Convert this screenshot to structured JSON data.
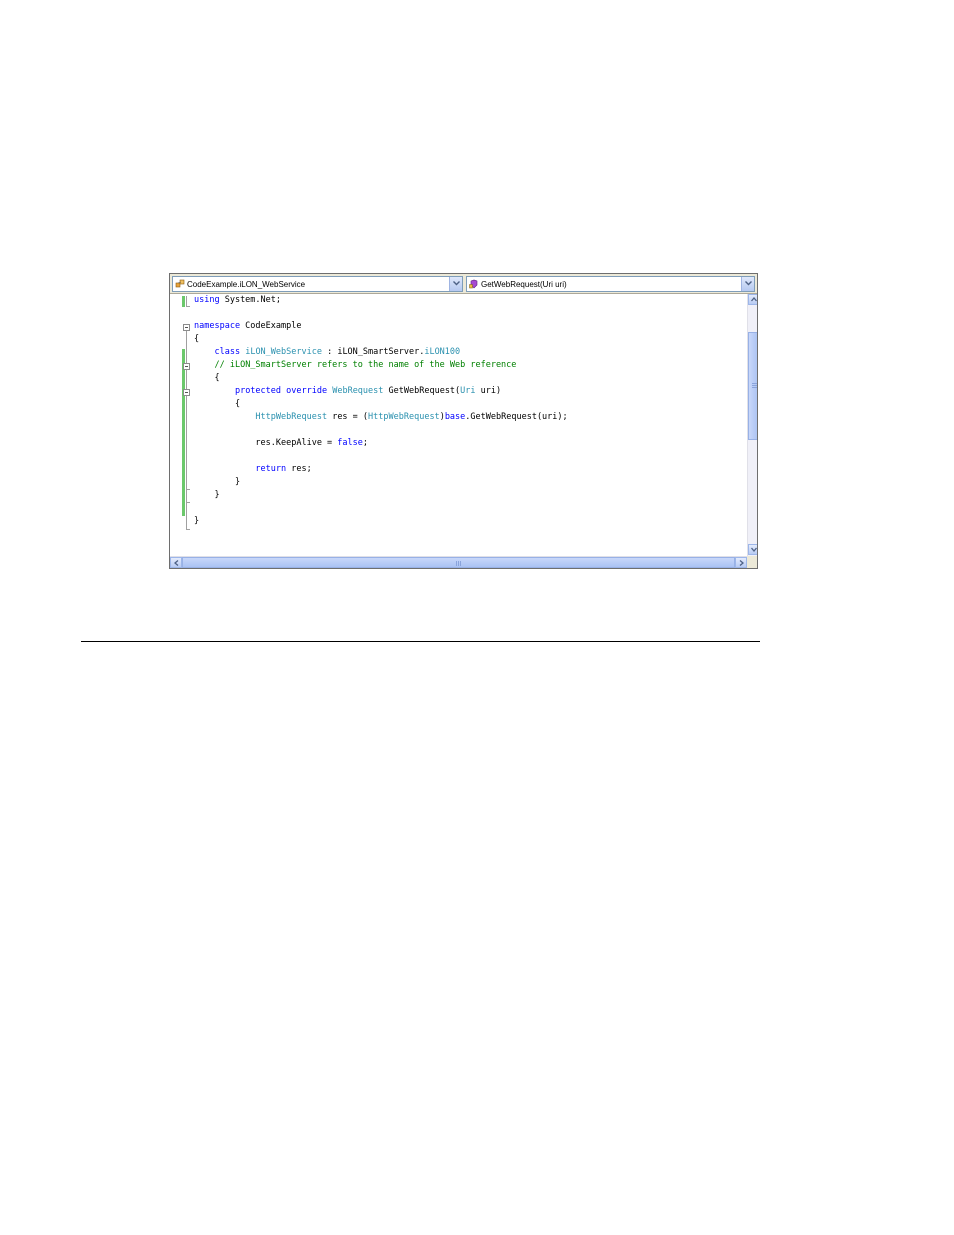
{
  "navigation": {
    "type_combo": {
      "text": "CodeExample.iLON_WebService",
      "icon": "class-icon"
    },
    "member_combo": {
      "text": "GetWebRequest(Uri uri)",
      "icon": "method-icon"
    }
  },
  "code_lines": {
    "l1": [
      {
        "t": "using",
        "c": "kw"
      },
      {
        "t": " System.Net;"
      }
    ],
    "l3": [
      {
        "t": "namespace",
        "c": "kw"
      },
      {
        "t": " CodeExample"
      }
    ],
    "l4": [
      {
        "t": "{"
      }
    ],
    "l5": [
      {
        "t": "    "
      },
      {
        "t": "class",
        "c": "kw"
      },
      {
        "t": " "
      },
      {
        "t": "iLON_WebService",
        "c": "ty"
      },
      {
        "t": " : iLON_SmartServer."
      },
      {
        "t": "iLON100",
        "c": "ty"
      }
    ],
    "l6": [
      {
        "t": "    "
      },
      {
        "t": "// iLON_SmartServer refers to the name of the Web reference",
        "c": "cm"
      }
    ],
    "l7": [
      {
        "t": "    {"
      }
    ],
    "l8": [
      {
        "t": "        "
      },
      {
        "t": "protected",
        "c": "kw"
      },
      {
        "t": " "
      },
      {
        "t": "override",
        "c": "kw"
      },
      {
        "t": " "
      },
      {
        "t": "WebRequest",
        "c": "ty"
      },
      {
        "t": " GetWebRequest("
      },
      {
        "t": "Uri",
        "c": "ty"
      },
      {
        "t": " uri)"
      }
    ],
    "l9": [
      {
        "t": "        {"
      }
    ],
    "l10": [
      {
        "t": "            "
      },
      {
        "t": "HttpWebRequest",
        "c": "ty"
      },
      {
        "t": " res = ("
      },
      {
        "t": "HttpWebRequest",
        "c": "ty"
      },
      {
        "t": ")"
      },
      {
        "t": "base",
        "c": "kw"
      },
      {
        "t": ".GetWebRequest(uri);"
      }
    ],
    "l12": [
      {
        "t": "            res.KeepAlive = "
      },
      {
        "t": "false",
        "c": "kw"
      },
      {
        "t": ";"
      }
    ],
    "l14": [
      {
        "t": "            "
      },
      {
        "t": "return",
        "c": "kw"
      },
      {
        "t": " res;"
      }
    ],
    "l15": [
      {
        "t": "        }"
      }
    ],
    "l16": [
      {
        "t": "    }"
      }
    ],
    "l18": [
      {
        "t": "}"
      }
    ]
  },
  "colors": {
    "keyword": "#0000ff",
    "type": "#2b91af",
    "comment": "#008000",
    "changed_line_marker": "#6cc86c"
  }
}
